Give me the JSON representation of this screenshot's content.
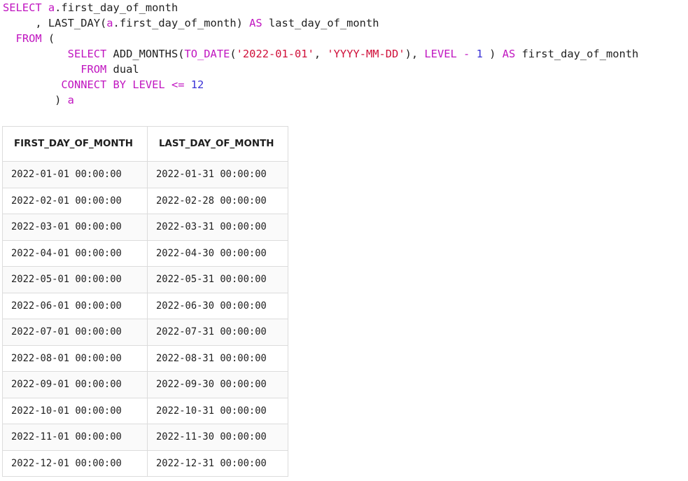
{
  "sql": {
    "lines": [
      [
        {
          "t": "SELECT ",
          "c": "kw"
        },
        {
          "t": "a",
          "c": "alias"
        },
        {
          "t": ".first_day_of_month",
          "c": ""
        }
      ],
      [
        {
          "t": "     , LAST_DAY(",
          "c": ""
        },
        {
          "t": "a",
          "c": "alias"
        },
        {
          "t": ".first_day_of_month) ",
          "c": ""
        },
        {
          "t": "AS",
          "c": "kw"
        },
        {
          "t": " last_day_of_month",
          "c": ""
        }
      ],
      [
        {
          "t": "  ",
          "c": ""
        },
        {
          "t": "FROM",
          "c": "kw"
        },
        {
          "t": " (",
          "c": ""
        }
      ],
      [
        {
          "t": "          ",
          "c": ""
        },
        {
          "t": "SELECT",
          "c": "kw"
        },
        {
          "t": " ADD_MONTHS(",
          "c": ""
        },
        {
          "t": "TO_DATE",
          "c": "kw"
        },
        {
          "t": "(",
          "c": ""
        },
        {
          "t": "'2022-01-01'",
          "c": "str"
        },
        {
          "t": ", ",
          "c": ""
        },
        {
          "t": "'YYYY-MM-DD'",
          "c": "str"
        },
        {
          "t": "), ",
          "c": ""
        },
        {
          "t": "LEVEL",
          "c": "kw"
        },
        {
          "t": " ",
          "c": ""
        },
        {
          "t": "-",
          "c": "kw"
        },
        {
          "t": " ",
          "c": ""
        },
        {
          "t": "1",
          "c": "num"
        },
        {
          "t": " ) ",
          "c": ""
        },
        {
          "t": "AS",
          "c": "kw"
        },
        {
          "t": " first_day_of_month",
          "c": ""
        }
      ],
      [
        {
          "t": "            ",
          "c": ""
        },
        {
          "t": "FROM",
          "c": "kw"
        },
        {
          "t": " dual",
          "c": ""
        }
      ],
      [
        {
          "t": "         ",
          "c": ""
        },
        {
          "t": "CONNECT BY LEVEL",
          "c": "kw"
        },
        {
          "t": " ",
          "c": ""
        },
        {
          "t": "<=",
          "c": "kw"
        },
        {
          "t": " ",
          "c": ""
        },
        {
          "t": "12",
          "c": "num"
        }
      ],
      [
        {
          "t": "        ) ",
          "c": ""
        },
        {
          "t": "a",
          "c": "alias"
        }
      ]
    ]
  },
  "result": {
    "columns": [
      "FIRST_DAY_OF_MONTH",
      "LAST_DAY_OF_MONTH"
    ],
    "rows": [
      [
        "2022-01-01 00:00:00",
        "2022-01-31 00:00:00"
      ],
      [
        "2022-02-01 00:00:00",
        "2022-02-28 00:00:00"
      ],
      [
        "2022-03-01 00:00:00",
        "2022-03-31 00:00:00"
      ],
      [
        "2022-04-01 00:00:00",
        "2022-04-30 00:00:00"
      ],
      [
        "2022-05-01 00:00:00",
        "2022-05-31 00:00:00"
      ],
      [
        "2022-06-01 00:00:00",
        "2022-06-30 00:00:00"
      ],
      [
        "2022-07-01 00:00:00",
        "2022-07-31 00:00:00"
      ],
      [
        "2022-08-01 00:00:00",
        "2022-08-31 00:00:00"
      ],
      [
        "2022-09-01 00:00:00",
        "2022-09-30 00:00:00"
      ],
      [
        "2022-10-01 00:00:00",
        "2022-10-31 00:00:00"
      ],
      [
        "2022-11-01 00:00:00",
        "2022-11-30 00:00:00"
      ],
      [
        "2022-12-01 00:00:00",
        "2022-12-31 00:00:00"
      ]
    ]
  },
  "colors": {
    "keyword": "#c015c0",
    "string": "#d0103a",
    "number": "#3b33d6",
    "text": "#1f1f1f",
    "grid": "#dcdcdc"
  }
}
